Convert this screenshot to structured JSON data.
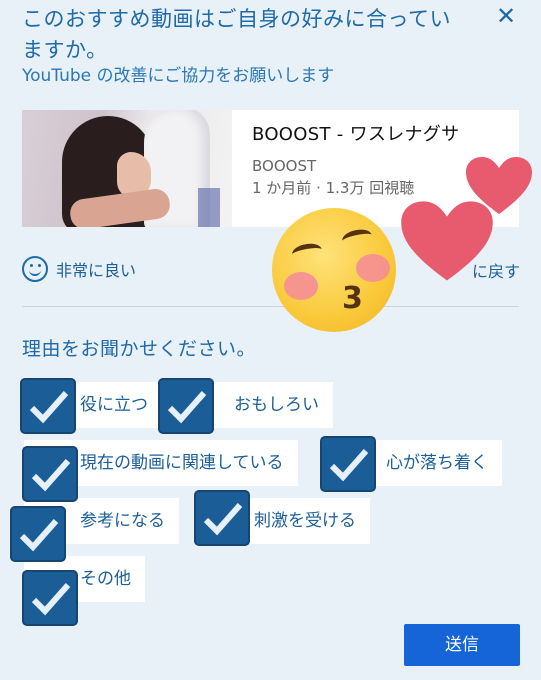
{
  "dialog": {
    "title": "このおすすめ動画はご自身の好みに合っていますか。",
    "subtitle": "YouTube の改善にご協力をお願いします",
    "close_icon": "close-icon"
  },
  "video": {
    "title": "BOOOST - ワスレナグサ",
    "channel": "BOOOST",
    "stats": "1 か月前 · 1.3万 回視聴"
  },
  "rating": {
    "icon": "smiley-icon",
    "label": "非常に良い",
    "back_label": "に戻す"
  },
  "reasons": {
    "heading": "理由をお聞かせください。",
    "options": [
      {
        "label": "役に立つ",
        "checked": true
      },
      {
        "label": "おもしろい",
        "checked": true
      },
      {
        "label": "現在の動画に関連している",
        "checked": true
      },
      {
        "label": "心が落ち着く",
        "checked": true
      },
      {
        "label": "参考になる",
        "checked": true
      },
      {
        "label": "刺激を受ける",
        "checked": true
      },
      {
        "label": "その他",
        "checked": true
      }
    ]
  },
  "submit": {
    "label": "送信"
  },
  "colors": {
    "accent": "#1f6aa8",
    "checkbox": "#1b5d97",
    "submit": "#1565d8",
    "heart": "#e85a6e"
  }
}
